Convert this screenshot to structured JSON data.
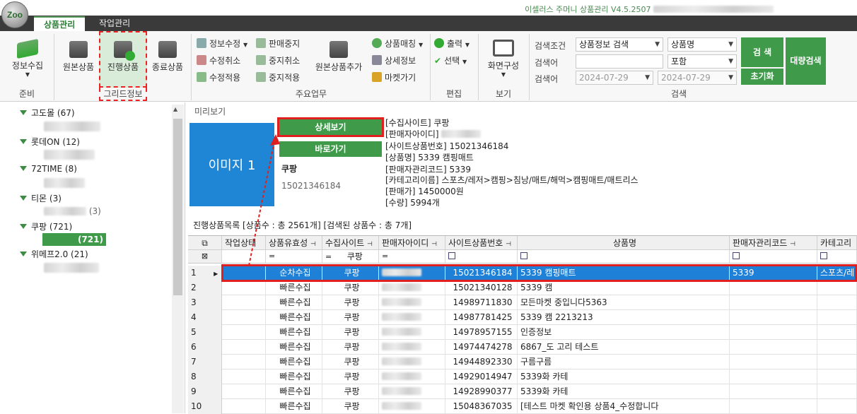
{
  "app": {
    "logo_text": "Zoo",
    "title": "이셀러스 주머니 상품관리 V4.5.2507"
  },
  "tabs": [
    {
      "label": "상품관리",
      "active": true
    },
    {
      "label": "작업관리",
      "active": false
    }
  ],
  "ribbon": {
    "prep": {
      "label": "준비",
      "collect_label": "정보수집"
    },
    "grid_info": {
      "label": "그리드정보",
      "original_label": "원본상품",
      "active_label": "진행상품",
      "ended_label": "종료상품"
    },
    "main_tasks": {
      "label": "주요업무",
      "edit_info": "정보수정",
      "edit_cancel": "수정취소",
      "edit_apply": "수정적용",
      "stop_sale": "판매중지",
      "stop_cancel": "중지취소",
      "stop_apply": "중지적용",
      "add_original": "원본상품추가",
      "product_match": "상품매칭",
      "detail_info": "상세정보",
      "go_market": "마켓가기"
    },
    "edit": {
      "label": "편집",
      "print": "출력",
      "select": "선택"
    },
    "view": {
      "label": "보기",
      "screen_config": "화면구성"
    },
    "search": {
      "label": "검색",
      "cond_label": "검색조건",
      "keyword_label1": "검색어",
      "keyword_label2": "검색어",
      "cond_value": "상품정보 검색",
      "field_value": "상품명",
      "match_value": "포함",
      "keyword_value": "",
      "date_from": "2024-07-29",
      "date_to": "2024-07-29",
      "search_btn": "검 색",
      "reset_btn": "초기화",
      "bulk_btn": "대량검색"
    }
  },
  "tree": [
    {
      "label": "고도몰 (67)"
    },
    {
      "label": "롯데ON (12)"
    },
    {
      "label": "72TIME (8)"
    },
    {
      "label": "티몬 (3)",
      "child": "(3)"
    },
    {
      "label": "쿠팡 (721)",
      "child": "(721)"
    },
    {
      "label": "위메프2.0 (21)"
    }
  ],
  "preview": {
    "section_label": "미리보기",
    "image_label": "이미지 1",
    "detail_btn": "상세보기",
    "direct_btn": "바로가기",
    "site": "쿠팡",
    "product_no": "15021346184",
    "info": [
      "[수집사이트] 쿠팡",
      "[판매자아이디]",
      "[사이트상품번호] 15021346184",
      "[상품명] 5339 캠핑매트",
      "[판매자관리코드] 5339",
      "[카테고리이름] 스포츠/레저>캠핑>침낭/매트/해먹>캠핑매트/매트리스",
      "[판매가] 1450000원",
      "[수량] 5994개"
    ]
  },
  "list": {
    "title": "진행상품목록 [상품수 : 총 2561개] [검색된 상품수 : 총 7개]",
    "columns": [
      "작업상태",
      "상품유효성",
      "수집사이트",
      "판매자아이디",
      "사이트상품번호",
      "상품명",
      "판매자관리코드",
      "카테고리"
    ],
    "filter_site": "쿠팡",
    "rows": [
      {
        "no": "1",
        "validity": "순차수집",
        "site": "쿠팡",
        "site_no": "15021346184",
        "name": "5339 캠핑매트",
        "code": "5339",
        "category": "스포츠/레"
      },
      {
        "no": "2",
        "validity": "빠른수집",
        "site": "쿠팡",
        "site_no": "15021340128",
        "name": "5339 캠",
        "code": "",
        "category": ""
      },
      {
        "no": "3",
        "validity": "빠른수집",
        "site": "쿠팡",
        "site_no": "14989711830",
        "name": "모든마켓 중입니다5363",
        "code": "",
        "category": ""
      },
      {
        "no": "4",
        "validity": "빠른수집",
        "site": "쿠팡",
        "site_no": "14987781425",
        "name": "5339 캠 2213213",
        "code": "",
        "category": ""
      },
      {
        "no": "5",
        "validity": "빠른수집",
        "site": "쿠팡",
        "site_no": "14978957155",
        "name": "인증정보",
        "code": "",
        "category": ""
      },
      {
        "no": "6",
        "validity": "빠른수집",
        "site": "쿠팡",
        "site_no": "14974474278",
        "name": "6867_도 고리 테스트",
        "code": "",
        "category": ""
      },
      {
        "no": "7",
        "validity": "빠른수집",
        "site": "쿠팡",
        "site_no": "14944892330",
        "name": "구름구름",
        "code": "",
        "category": ""
      },
      {
        "no": "8",
        "validity": "빠른수집",
        "site": "쿠팡",
        "site_no": "14929014947",
        "name": "5339화 카테",
        "code": "",
        "category": ""
      },
      {
        "no": "9",
        "validity": "빠른수집",
        "site": "쿠팡",
        "site_no": "14928990377",
        "name": "5339화 카테",
        "code": "",
        "category": ""
      },
      {
        "no": "10",
        "validity": "빠른수집",
        "site": "쿠팡",
        "site_no": "15048367035",
        "name": "[테스트 마켓 확인용 상품4_수정합니다",
        "code": "",
        "category": ""
      }
    ]
  },
  "colors": {
    "accent_green": "#3f9a4a",
    "selection_blue": "#1f80d8",
    "highlight_red": "#e02020"
  }
}
